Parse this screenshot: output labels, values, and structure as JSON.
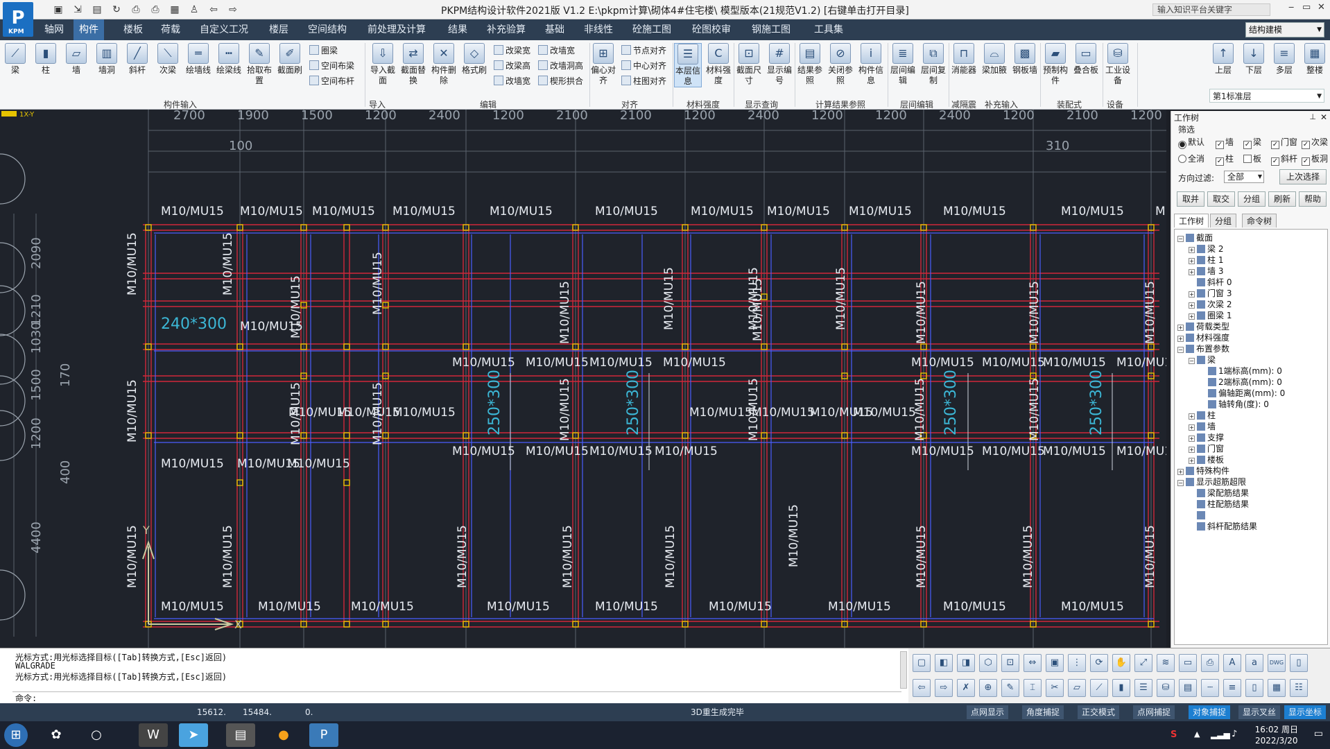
{
  "app": {
    "logo_text": "P",
    "logo_sub": "KPM",
    "title": "PKPM结构设计软件2021版 V1.2 E:\\pkpm计算\\砌体4#住宅楼\\ 模型版本(21规范V1.2)   [右键单击打开目录]",
    "search_placeholder": "输入知识平台关键字",
    "window_controls": [
      "‒",
      "▭",
      "✕"
    ]
  },
  "menu": {
    "items": [
      "轴网",
      "构件",
      "楼板",
      "荷载",
      "自定义工况",
      "楼层",
      "空间结构",
      "前处理及计算",
      "结果",
      "补充验算",
      "基础",
      "非线性",
      "砼施工图",
      "砼图校审",
      "钢施工图",
      "工具集"
    ],
    "active": "构件",
    "module_combo": "结构建模"
  },
  "ribbon": {
    "buttons": [
      "梁",
      "柱",
      "墙",
      "墙洞",
      "斜杆",
      "次梁",
      "绘墙线",
      "绘梁线",
      "拾取布置",
      "截面刷",
      "导入截面",
      "截面替换",
      "构件删除",
      "格式刷",
      "偏心对齐",
      "本层信息",
      "材料强度",
      "截面尺寸",
      "显示编号",
      "结果参照",
      "关闭参照",
      "构件信息",
      "层间编辑",
      "层间复制",
      "消能器",
      "梁加腋",
      "钢板墙",
      "预制构件",
      "叠合板",
      "工业设备",
      "上层",
      "下层",
      "多层",
      "整楼"
    ],
    "small_col1": [
      "圈梁",
      "空间布梁",
      "空间布杆"
    ],
    "small_col2": [
      "改梁宽",
      "改梁高",
      "改墙宽"
    ],
    "small_col3": [
      "改墙宽",
      "改墙洞高",
      "楔形拱合"
    ],
    "small_col4": [
      "节点对齐",
      "中心对齐",
      "柱图对齐"
    ],
    "groups": [
      "构件输入",
      "导入",
      "编辑",
      "对齐",
      "材料强度",
      "显示查询",
      "计算结果参照",
      "层间编辑",
      "减隔震",
      "补充输入",
      "装配式",
      "设备"
    ],
    "layer_combo": "第1标准层"
  },
  "canvas": {
    "axis_tag": "1X-Y",
    "top_dims": [
      "2700",
      "1900",
      "1500",
      "1200",
      "2400",
      "1200",
      "2100",
      "2100",
      "1200",
      "2400",
      "1200",
      "1200",
      "2400",
      "1200",
      "2100",
      "1200"
    ],
    "top_small": [
      "100",
      "310"
    ],
    "left_dims": [
      "2090",
      "1210",
      "1030",
      "1500",
      "1200",
      "4400"
    ],
    "left_small": [
      "170",
      "400"
    ],
    "wall_label": "M10/MU15",
    "beam_labels": [
      "240*300",
      "250*300"
    ],
    "axis_y": "Y",
    "axis_x": "X"
  },
  "panel": {
    "title": "工作树",
    "filter_label": "筛选",
    "radio_default": "默认",
    "radio_all": "全消",
    "checks_row1": [
      "墙",
      "梁",
      "门窗",
      "次梁"
    ],
    "checks_row2": [
      "柱",
      "板",
      "斜杆",
      "板洞"
    ],
    "direction_label": "方向过滤:",
    "direction_value": "全部",
    "last_select": "上次选择",
    "buttons": [
      "取并",
      "取交",
      "分组",
      "刷新",
      "帮助"
    ],
    "tabs": [
      "工作树",
      "分组",
      "命令树"
    ],
    "tree": [
      {
        "label": "截面",
        "level": 0,
        "sign": "−"
      },
      {
        "label": "梁 2",
        "level": 1,
        "sign": "+"
      },
      {
        "label": "柱 1",
        "level": 1,
        "sign": "+"
      },
      {
        "label": "墙 3",
        "level": 1,
        "sign": "+"
      },
      {
        "label": "斜杆 0",
        "level": 1,
        "sign": ""
      },
      {
        "label": "门窗 3",
        "level": 1,
        "sign": "+"
      },
      {
        "label": "次梁 2",
        "level": 1,
        "sign": "+"
      },
      {
        "label": "圈梁 1",
        "level": 1,
        "sign": "+"
      },
      {
        "label": "荷载类型",
        "level": 0,
        "sign": "+"
      },
      {
        "label": "材料强度",
        "level": 0,
        "sign": "+"
      },
      {
        "label": "布置参数",
        "level": 0,
        "sign": "−"
      },
      {
        "label": "梁",
        "level": 1,
        "sign": "−"
      },
      {
        "label": "1端标高(mm): 0",
        "level": 2,
        "sign": ""
      },
      {
        "label": "2端标高(mm): 0",
        "level": 2,
        "sign": ""
      },
      {
        "label": "偏轴距离(mm): 0",
        "level": 2,
        "sign": ""
      },
      {
        "label": "轴转角(度): 0",
        "level": 2,
        "sign": ""
      },
      {
        "label": "柱",
        "level": 1,
        "sign": "+"
      },
      {
        "label": "墙",
        "level": 1,
        "sign": "+"
      },
      {
        "label": "支撑",
        "level": 1,
        "sign": "+"
      },
      {
        "label": "门窗",
        "level": 1,
        "sign": "+"
      },
      {
        "label": "楼板",
        "level": 1,
        "sign": "+"
      },
      {
        "label": "特殊构件",
        "level": 0,
        "sign": "+"
      },
      {
        "label": "显示超筋超限",
        "level": 0,
        "sign": "−"
      },
      {
        "label": "梁配筋结果",
        "level": 1,
        "sign": ""
      },
      {
        "label": "柱配筋结果",
        "level": 1,
        "sign": ""
      },
      {
        "label": "",
        "level": 1,
        "sign": ""
      },
      {
        "label": "斜杆配筋结果",
        "level": 1,
        "sign": ""
      }
    ]
  },
  "command": {
    "lines": [
      "光标方式:用光标选择目标([Tab]转换方式,[Esc]返回)",
      "WALGRADE",
      "光标方式:用光标选择目标([Tab]转换方式,[Esc]返回)"
    ],
    "prompt": "命令:"
  },
  "status": {
    "x": "15612.",
    "y": "15484.",
    "z": "0.",
    "message": "3D重生成完毕",
    "buttons": [
      "点网显示",
      "角度捕捉",
      "正交模式",
      "点网捕捉",
      "对象捕捉",
      "显示叉丝",
      "显示坐标"
    ],
    "active_buttons": [
      "对象捕捉",
      "显示坐标"
    ]
  },
  "taskbar": {
    "time": "16:02 周日",
    "date": "2022/3/20"
  },
  "colors": {
    "canvas_bg": "#1f232b",
    "wall_red": "#d0283a",
    "beam_blue": "#4a5dff",
    "label_white": "#e8ecf2",
    "dim_gray": "#9aa3ad",
    "node_yellow": "#e6c300",
    "beam_label_cyan": "#3cb7d6",
    "menu_bg": "#2d3e52"
  }
}
